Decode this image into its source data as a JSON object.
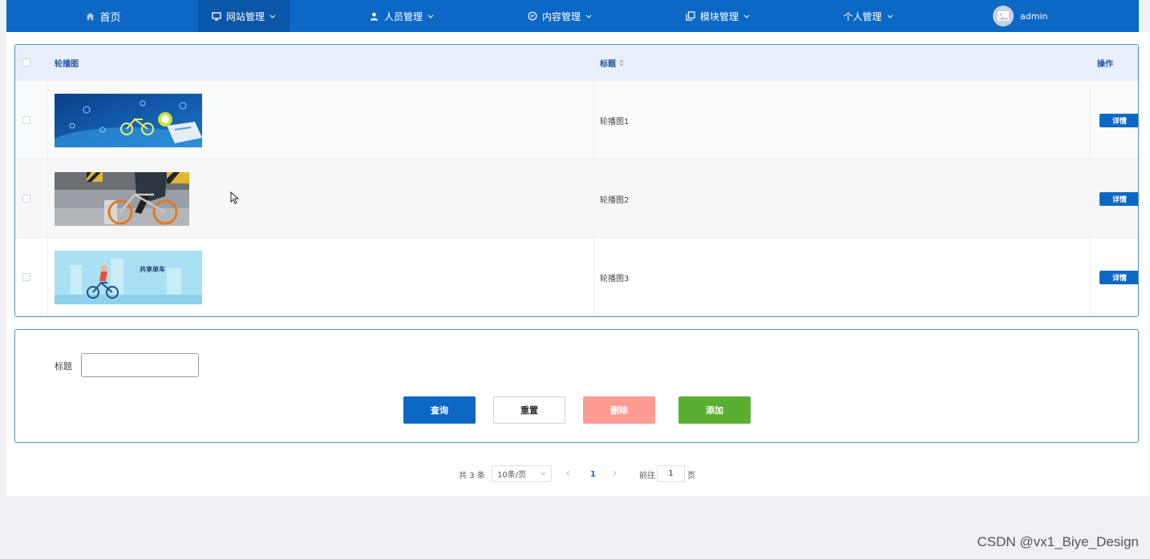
{
  "colors": {
    "nav_bg": "#0d68c5",
    "nav_active": "#0a56a8",
    "primary": "#0d68c5",
    "danger": "#fd9a91",
    "success": "#5aaf32",
    "header_bg": "#e8eefa",
    "header_text": "#1e56a0"
  },
  "nav": {
    "items": [
      {
        "label": "首页",
        "icon": "home-icon"
      },
      {
        "label": "网站管理",
        "icon": "monitor-icon",
        "active": true
      },
      {
        "label": "人员管理",
        "icon": "user-icon"
      },
      {
        "label": "内容管理",
        "icon": "chat-icon"
      },
      {
        "label": "模块管理",
        "icon": "copy-icon"
      },
      {
        "label": "个人管理",
        "icon": ""
      }
    ],
    "user": {
      "name": "admin",
      "icon": "avatar-image-icon"
    }
  },
  "table": {
    "columns": {
      "image": "轮播图",
      "title": "标题",
      "actions": "操作"
    },
    "rows": [
      {
        "title": "轮播图1",
        "action": "详情",
        "image": "banner-bike-map"
      },
      {
        "title": "轮播图2",
        "action": "详情",
        "image": "banner-bike-street"
      },
      {
        "title": "轮播图3",
        "action": "详情",
        "image": "banner-bike-illustration"
      }
    ],
    "row3_image_text": "共享单车"
  },
  "search": {
    "title_label": "标题",
    "title_value": "",
    "buttons": {
      "query": "查询",
      "reset": "重置",
      "delete": "删除",
      "add": "添加"
    }
  },
  "pagination": {
    "total": "共 3 条",
    "page_size": "10条/页",
    "current_page": "1",
    "goto_prefix": "前往",
    "goto_value": "1",
    "goto_suffix": "页"
  },
  "watermark": "CSDN @vx1_Biye_Design"
}
